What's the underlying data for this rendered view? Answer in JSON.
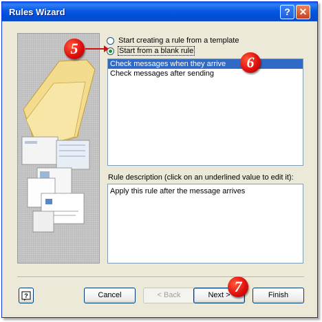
{
  "window": {
    "title": "Rules Wizard",
    "help_button": "?",
    "close_button": "✕"
  },
  "options": {
    "template": "Start creating a rule from a template",
    "blank": "Start from a blank rule",
    "selected": "blank"
  },
  "list": {
    "items": [
      "Check messages when they arrive",
      "Check messages after sending"
    ],
    "selected_index": 0
  },
  "description": {
    "label": "Rule description (click on an underlined value to edit it):",
    "text": "Apply this rule after the message arrives"
  },
  "buttons": {
    "help": "?",
    "cancel": "Cancel",
    "back": "< Back",
    "next": "Next >",
    "finish": "Finish"
  },
  "callouts": {
    "step5": "5",
    "step6": "6",
    "step7": "7"
  }
}
